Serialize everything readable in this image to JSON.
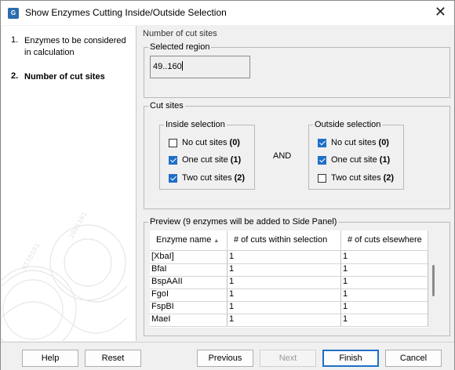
{
  "window": {
    "title": "Show Enzymes Cutting Inside/Outside Selection",
    "app_icon_text": "G"
  },
  "sidebar": {
    "steps": [
      {
        "num": "1.",
        "label": "Enzymes to be considered in calculation"
      },
      {
        "num": "2.",
        "label": "Number of cut sites"
      }
    ],
    "active_step": 2
  },
  "main": {
    "section_title": "Number of cut sites",
    "selected_region": {
      "legend": "Selected region",
      "value": "49..160"
    },
    "cut_sites": {
      "legend": "Cut sites",
      "and_label": "AND",
      "inside": {
        "legend": "Inside selection",
        "options": [
          {
            "label": "No cut sites",
            "count": "(0)",
            "checked": false
          },
          {
            "label": "One cut site",
            "count": "(1)",
            "checked": true
          },
          {
            "label": "Two cut sites",
            "count": "(2)",
            "checked": true
          }
        ]
      },
      "outside": {
        "legend": "Outside selection",
        "options": [
          {
            "label": "No cut sites",
            "count": "(0)",
            "checked": true
          },
          {
            "label": "One cut site",
            "count": "(1)",
            "checked": true
          },
          {
            "label": "Two cut sites",
            "count": "(2)",
            "checked": false
          }
        ]
      }
    },
    "preview": {
      "legend": "Preview (9 enzymes will be added to Side Panel)",
      "columns": [
        "Enzyme name",
        "# of cuts within selection",
        "# of cuts elsewhere"
      ],
      "rows": [
        [
          "[XbaI]",
          "1",
          "1"
        ],
        [
          "BfaI",
          "1",
          "1"
        ],
        [
          "BspAAII",
          "1",
          "1"
        ],
        [
          "FgoI",
          "1",
          "1"
        ],
        [
          "FspBI",
          "1",
          "1"
        ],
        [
          "MaeI",
          "1",
          "1"
        ]
      ]
    }
  },
  "footer": {
    "help": "Help",
    "reset": "Reset",
    "previous": "Previous",
    "next": "Next",
    "finish": "Finish",
    "cancel": "Cancel"
  },
  "colors": {
    "accent": "#1f6fc8"
  }
}
